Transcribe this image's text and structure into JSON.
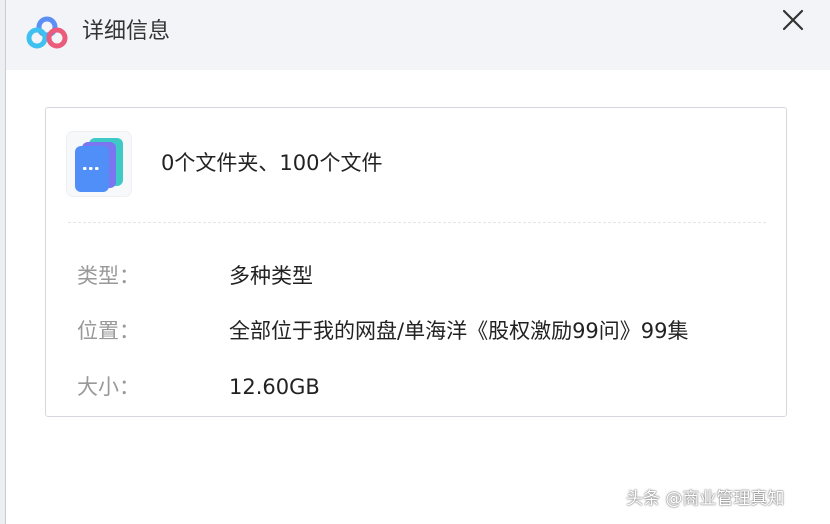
{
  "window": {
    "title": "详细信息",
    "app_icon": "baidu-netdisk-logo-icon",
    "close_icon": "close-icon"
  },
  "file_info": {
    "icon": "multi-file-icon",
    "summary": "0个文件夹、100个文件",
    "rows": [
      {
        "label": "类型：",
        "value": "多种类型"
      },
      {
        "label": "位置：",
        "value": "全部位于我的网盘/单海洋《股权激励99问》99集"
      },
      {
        "label": "大小：",
        "value": "12.60GB"
      }
    ]
  },
  "watermark": {
    "text": "头条 @商业管理真知"
  },
  "colors": {
    "title_bar_bg": "#f2f4f8",
    "label_text": "#999999",
    "value_text": "#222222",
    "file_icon_front": "#4f8ff7",
    "file_icon_back": "#3fc9c6",
    "file_icon_mid": "#7a75f0"
  }
}
